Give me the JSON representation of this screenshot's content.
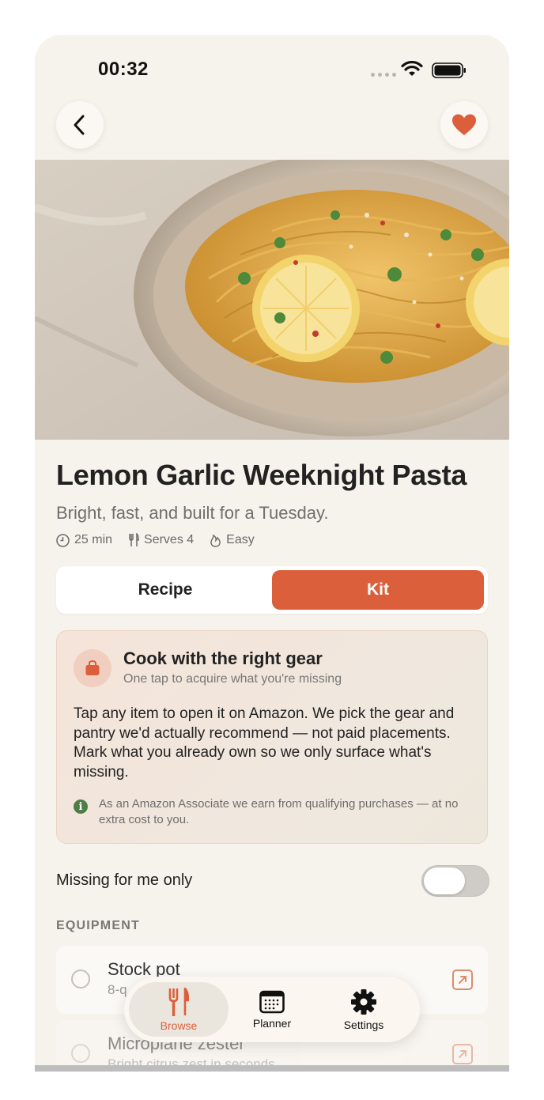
{
  "status_bar": {
    "time": "00:32"
  },
  "recipe": {
    "title": "Lemon Garlic Weeknight Pasta",
    "subtitle": "Bright, fast, and built for a Tuesday.",
    "meta": {
      "time": "25 min",
      "serves": "Serves 4",
      "difficulty": "Easy"
    }
  },
  "segmented": {
    "tabs": [
      "Recipe",
      "Kit"
    ],
    "selected": "Kit"
  },
  "gear_card": {
    "title": "Cook with the right gear",
    "subtitle": "One tap to acquire what you're missing",
    "body": "Tap any item to open it on Amazon. We pick the gear and pantry we'd actually recommend — not paid placements. Mark what you already own so we only surface what's missing.",
    "disclosure": "As an Amazon Associate we earn from qualifying purchases — at no extra cost to you."
  },
  "filter": {
    "label": "Missing for me only",
    "enabled": false
  },
  "equipment": {
    "section_label": "EQUIPMENT",
    "items": [
      {
        "name": "Stock pot",
        "description": "8-q"
      },
      {
        "name": "Microplane zester",
        "description": "Bright citrus zest in seconds"
      }
    ]
  },
  "tab_bar": {
    "items": [
      {
        "label": "Browse",
        "icon": "fork-knife-icon",
        "active": true
      },
      {
        "label": "Planner",
        "icon": "calendar-icon",
        "active": false
      },
      {
        "label": "Settings",
        "icon": "gear-icon",
        "active": false
      }
    ]
  },
  "colors": {
    "accent": "#dc5f3b",
    "background": "#f6f2ec",
    "success": "#4e7d47"
  }
}
